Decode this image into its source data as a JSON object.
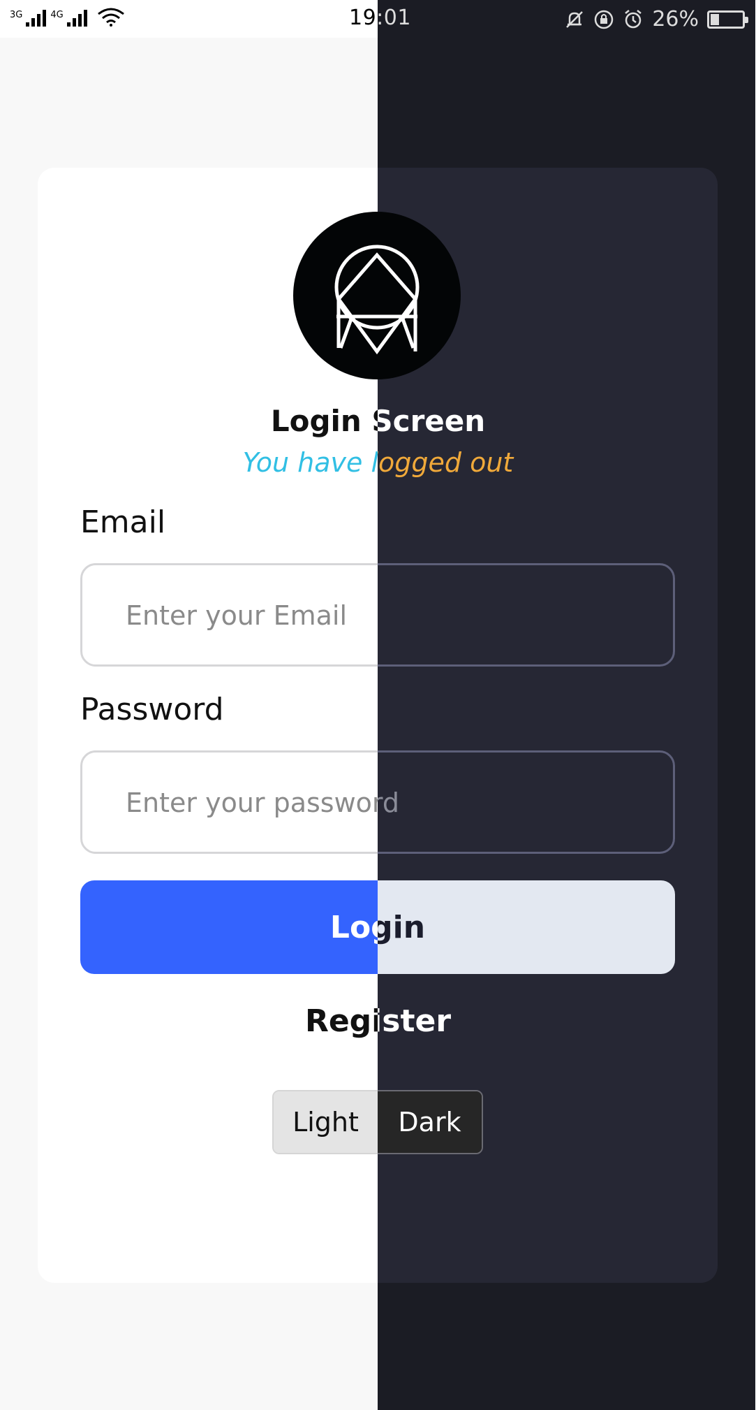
{
  "status_bar": {
    "network_1": "3G",
    "network_2": "4G",
    "time": "19:01",
    "battery_percent": "26%",
    "icons": [
      "signal-icon",
      "wifi-icon",
      "mute-icon",
      "rotation-lock-icon",
      "alarm-icon",
      "battery-icon"
    ]
  },
  "login": {
    "title": "Login Screen",
    "subtitle": "You have logged out",
    "email_label": "Email",
    "email_placeholder": "Enter your Email",
    "password_label": "Password",
    "password_placeholder": "Enter your password",
    "login_button": "Login",
    "register_link": "Register"
  },
  "theme_toggle": {
    "light_label": "Light",
    "dark_label": "Dark"
  },
  "colors": {
    "light_bg": "#f8f8f8",
    "dark_bg": "#1b1c24",
    "dark_card": "#262734",
    "primary_button": "#3463fe",
    "subtitle_light": "#31bfe4",
    "subtitle_dark": "#f0a93a"
  }
}
